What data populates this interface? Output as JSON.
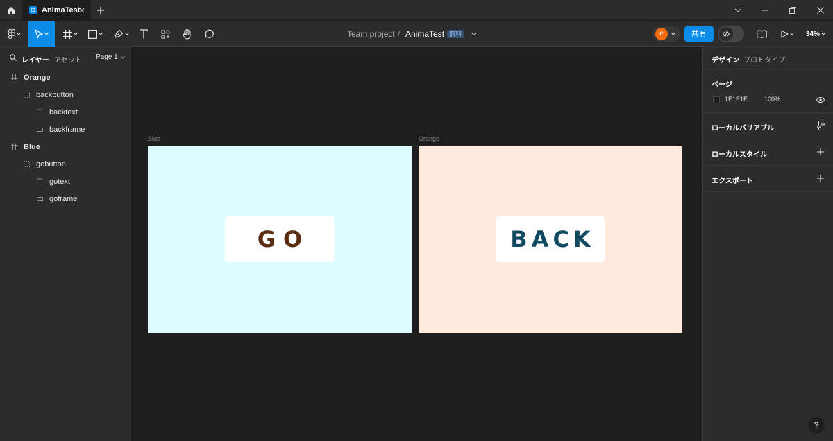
{
  "window": {
    "tab_title": "AnimaTest"
  },
  "toolbar": {
    "team_project": "Team project",
    "separator": "/",
    "file_name": "AnimaTest",
    "plan_badge": "無料",
    "avatar_initial": "e",
    "share_label": "共有",
    "zoom_label": "34%"
  },
  "left_panel": {
    "tab_layers": "レイヤー",
    "tab_assets": "アセット",
    "page_selector": "Page 1",
    "layers": [
      {
        "name": "Orange",
        "type": "frame"
      },
      {
        "name": "backbutton",
        "type": "group"
      },
      {
        "name": "backtext",
        "type": "text"
      },
      {
        "name": "backframe",
        "type": "rect"
      },
      {
        "name": "Blue",
        "type": "frame"
      },
      {
        "name": "gobutton",
        "type": "group"
      },
      {
        "name": "gotext",
        "type": "text"
      },
      {
        "name": "goframe",
        "type": "rect"
      }
    ]
  },
  "canvas": {
    "frames": [
      {
        "label": "Blue",
        "button_text": "GO",
        "bg_color": "#dcfcff",
        "text_color": "#5b2d10"
      },
      {
        "label": "Orange",
        "button_text": "BACK",
        "bg_color": "#ffebdd",
        "text_color": "#0f4a60"
      }
    ]
  },
  "right_panel": {
    "tab_design": "デザイン",
    "tab_prototype": "プロトタイプ",
    "page_section_title": "ページ",
    "page_color_hex": "1E1E1E",
    "page_color_opacity": "100%",
    "local_variables": "ローカルバリアブル",
    "local_styles": "ローカルスタイル",
    "export": "エクスポート",
    "help": "?"
  },
  "colors": {
    "accent": "#0c8ce9",
    "avatar": "#f26c0f",
    "panel": "#2c2c2c",
    "canvas": "#1e1e1e"
  }
}
